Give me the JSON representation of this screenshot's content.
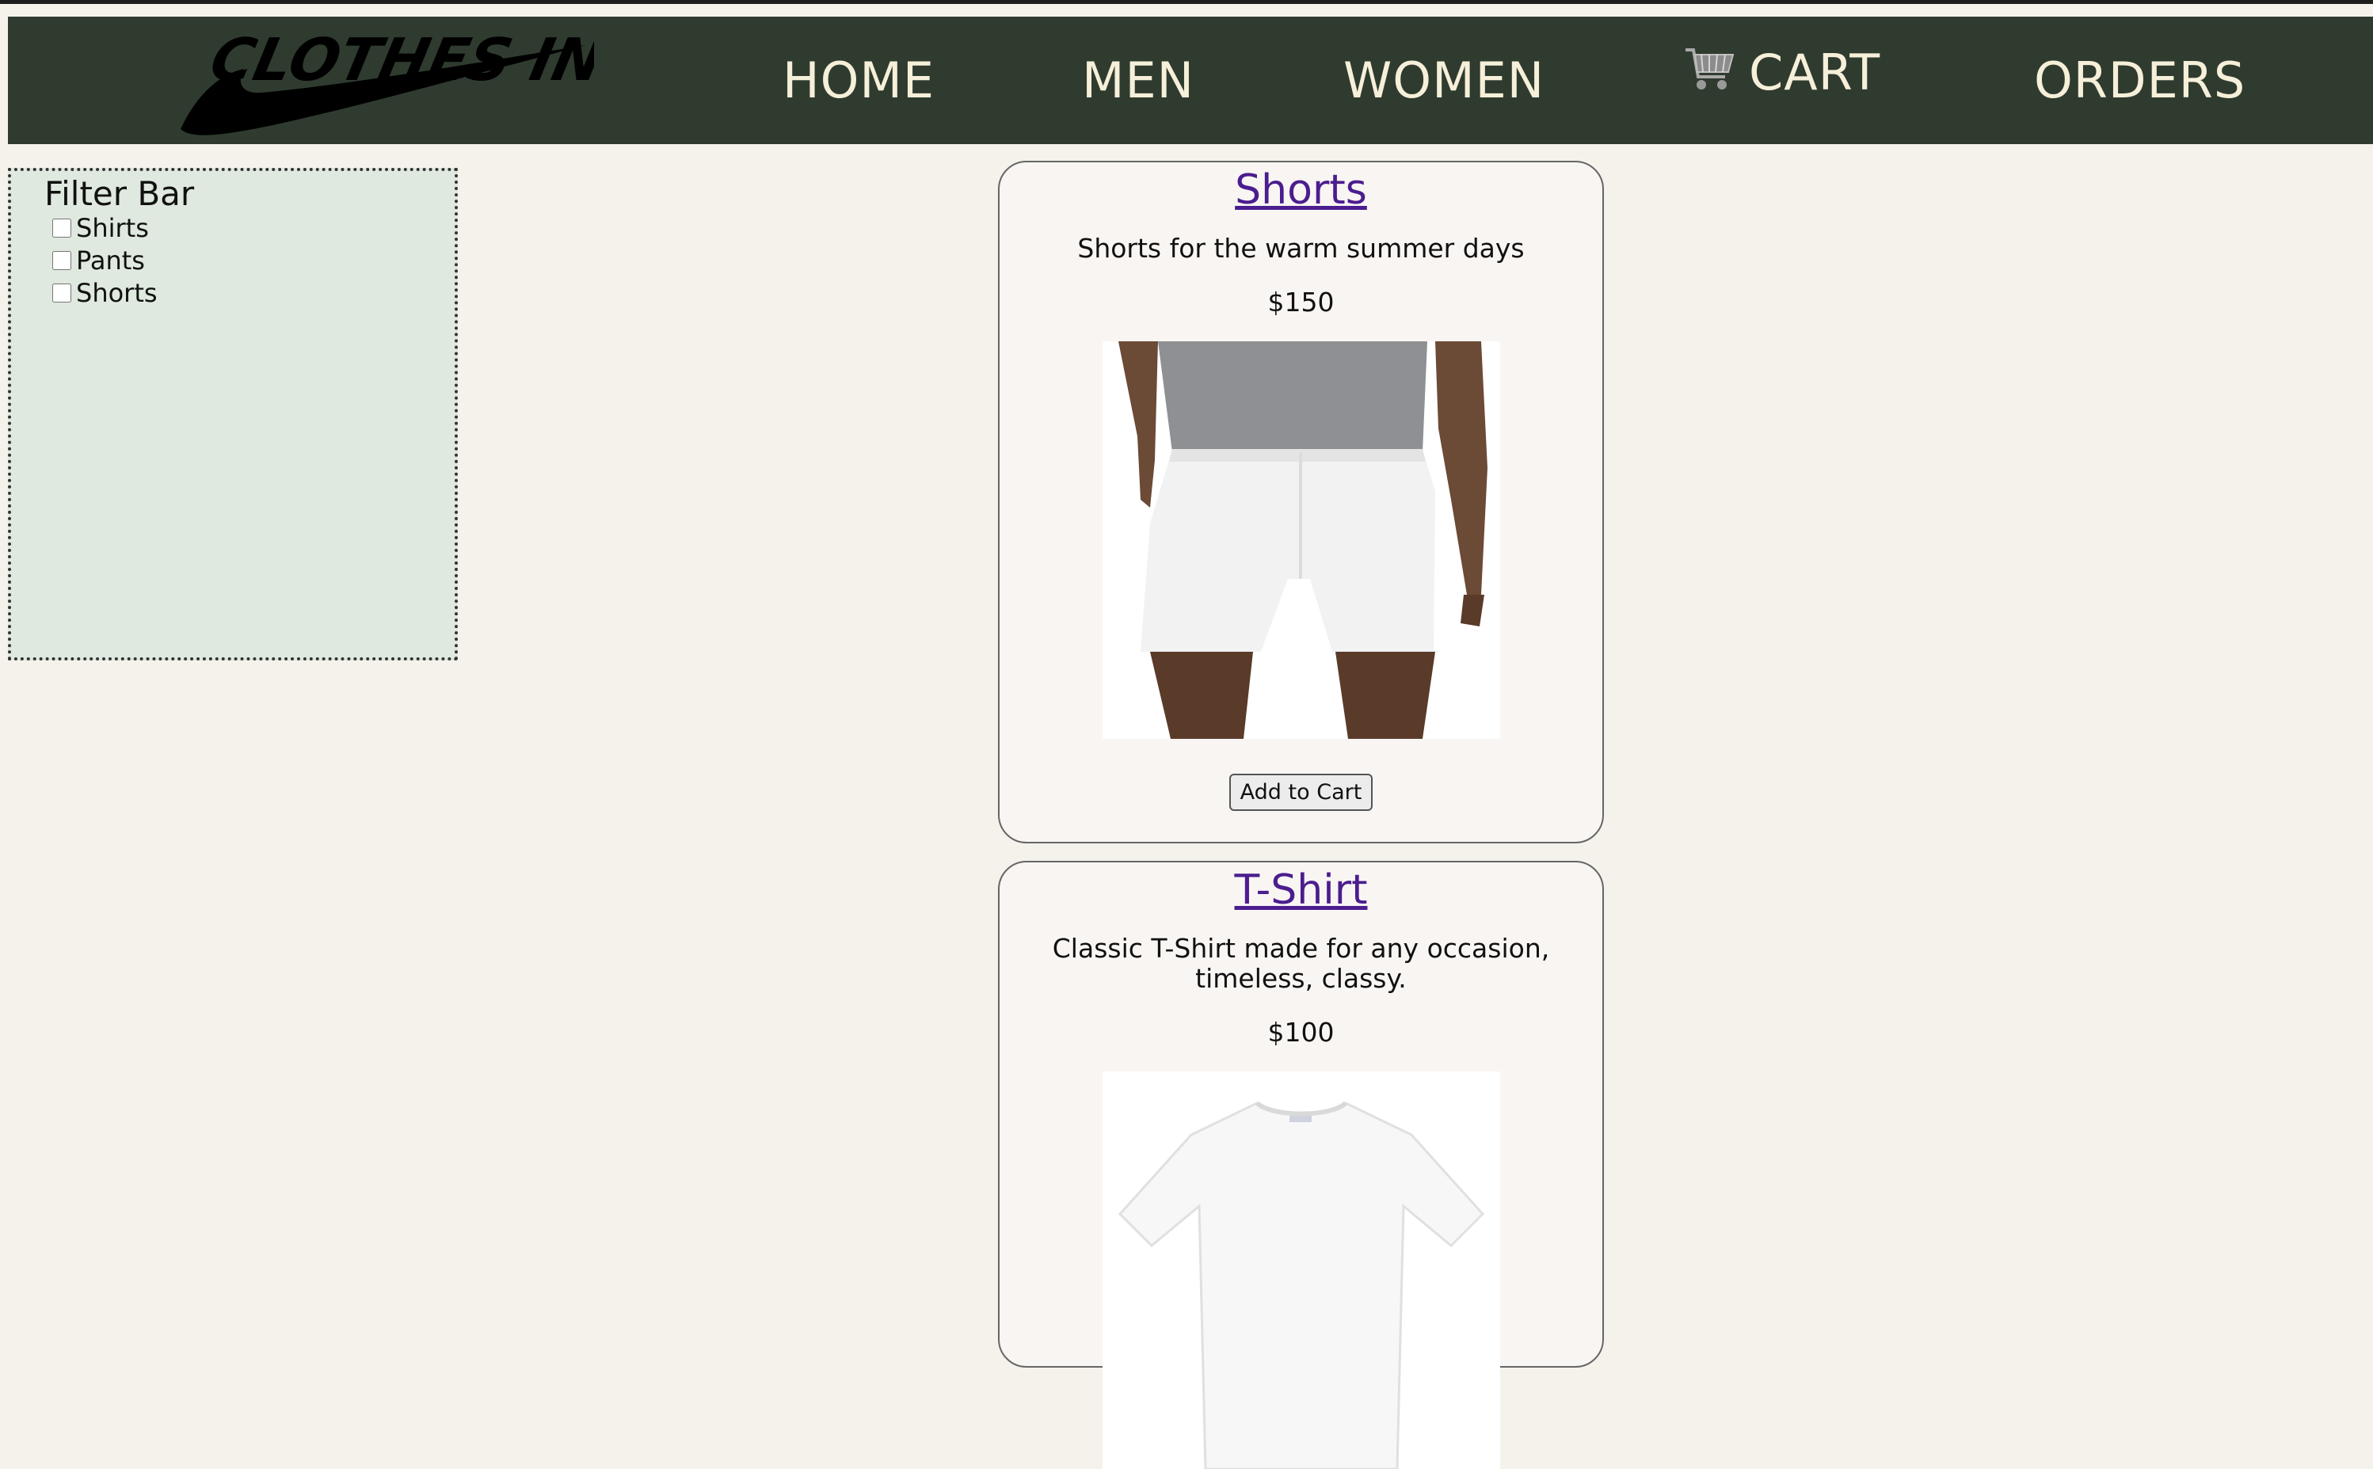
{
  "brand": {
    "logo_text": "CLOTHES INC"
  },
  "nav": {
    "home": "HOME",
    "men": "MEN",
    "women": "WOMEN",
    "cart": "CART",
    "orders": "ORDERS"
  },
  "filter": {
    "title": "Filter Bar",
    "options": [
      {
        "label": "Shirts",
        "checked": false
      },
      {
        "label": "Pants",
        "checked": false
      },
      {
        "label": "Shorts",
        "checked": false
      }
    ]
  },
  "products": [
    {
      "name": "Shorts",
      "description": "Shorts for the warm summer days",
      "price": "$150",
      "button": "Add to Cart"
    },
    {
      "name": "T-Shirt",
      "description": "Classic T-Shirt made for any occasion, timeless, classy.",
      "price": "$100"
    }
  ],
  "colors": {
    "nav_bg": "#2f3b2f",
    "nav_text": "#f6efd9",
    "page_bg": "#f5f2ec",
    "filter_bg": "#dfe9df",
    "link": "#4b1d8f",
    "card_bg": "#f8f5f3"
  },
  "icons": [
    "logo-swoosh",
    "shopping-cart-icon",
    "checkbox"
  ]
}
